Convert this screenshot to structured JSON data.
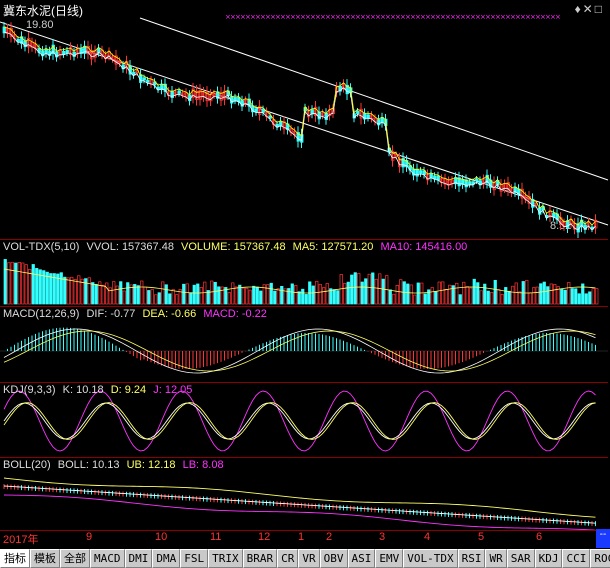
{
  "title": "冀东水泥(日线)",
  "top_icons": "♦✕□",
  "price_panel": {
    "high_label": "19.80",
    "low_label": "8.52",
    "colors": {
      "up": "#ff3333",
      "down": "#33ffff",
      "ma": "#ffffff",
      "ma2": "#ffff00",
      "marker": "#ff33ff"
    }
  },
  "indicators": {
    "vol": {
      "label": "VOL-TDX(5,10)",
      "vvol": "VVOL: 157367.48",
      "volume": "VOLUME: 157367.48",
      "ma5": "MA5: 127571.20",
      "ma10": "MA10: 145416.00"
    },
    "macd": {
      "label": "MACD(12,26,9)",
      "dif": "DIF: -0.77",
      "dea": "DEA: -0.66",
      "macd": "MACD: -0.22"
    },
    "kdj": {
      "label": "KDJ(9,3,3)",
      "k": "K: 10.18",
      "d": "D: 9.24",
      "j": "J: 12.05"
    },
    "boll": {
      "label": "BOLL(20)",
      "boll": "BOLL: 10.13",
      "ub": "UB: 12.18",
      "lb": "LB: 8.08"
    }
  },
  "date_axis": {
    "year": "2017年",
    "months": [
      "9",
      "10",
      "11",
      "12",
      "1",
      "2",
      "3",
      "4",
      "5",
      "6"
    ]
  },
  "tabs": [
    "指标",
    "模板",
    "全部",
    "MACD",
    "DMI",
    "DMA",
    "FSL",
    "TRIX",
    "BRAR",
    "CR",
    "VR",
    "OBV",
    "ASI",
    "EMV",
    "VOL-TDX",
    "RSI",
    "WR",
    "SAR",
    "KDJ",
    "CCI",
    "ROC"
  ],
  "corner_label": "--"
}
